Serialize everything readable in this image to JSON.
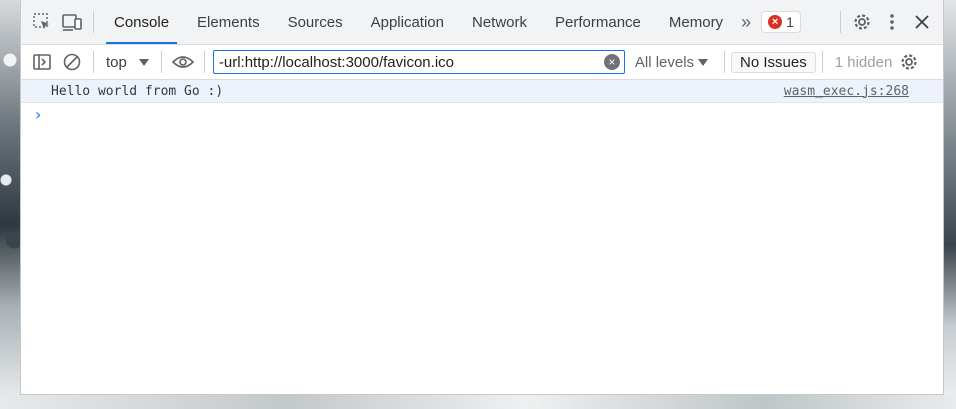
{
  "tabs": [
    {
      "label": "Console",
      "active": true
    },
    {
      "label": "Elements"
    },
    {
      "label": "Sources"
    },
    {
      "label": "Application"
    },
    {
      "label": "Network"
    },
    {
      "label": "Performance"
    },
    {
      "label": "Memory"
    }
  ],
  "error_count": "1",
  "console_toolbar": {
    "context": "top",
    "filter_value": "-url:http://localhost:3000/favicon.ico",
    "levels": "All levels",
    "issues_button": "No Issues",
    "hidden_count": "1 hidden"
  },
  "messages": [
    {
      "text": "Hello world from Go :)",
      "source": "wasm_exec.js:268"
    }
  ],
  "colors": {
    "accent": "#1a73e8",
    "error": "#d93025",
    "message_bg": "#eef3fb"
  }
}
